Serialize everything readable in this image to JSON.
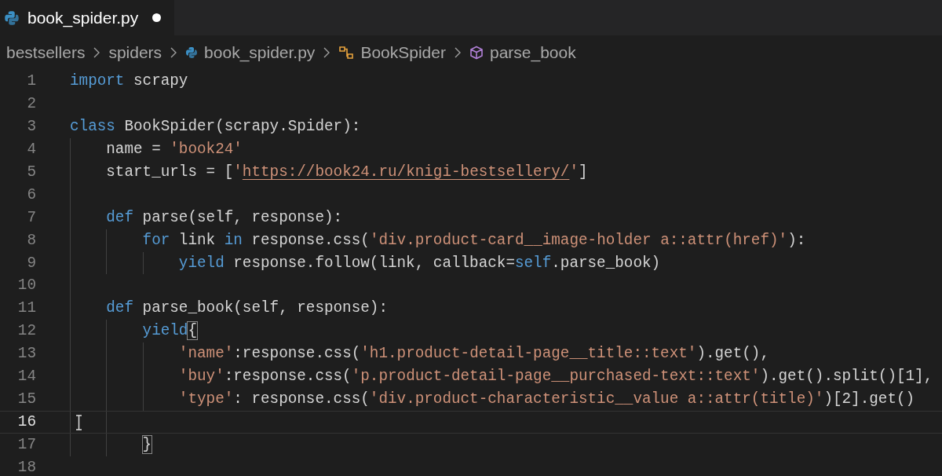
{
  "tab": {
    "title": "book_spider.py",
    "modified": true,
    "selected": true
  },
  "breadcrumbs": [
    {
      "kind": "folder",
      "label": "bestsellers"
    },
    {
      "kind": "folder",
      "label": "spiders"
    },
    {
      "kind": "file",
      "label": "book_spider.py"
    },
    {
      "kind": "class",
      "label": "BookSpider"
    },
    {
      "kind": "method",
      "label": "parse_book"
    }
  ],
  "lines": [
    {
      "number": "1",
      "active": false,
      "tokens": [
        {
          "kind": "kw",
          "text": "import"
        },
        {
          "kind": "plain",
          "text": " scrapy"
        }
      ]
    },
    {
      "number": "2",
      "active": false
    },
    {
      "number": "3",
      "active": false,
      "tokens": [
        {
          "kind": "kw",
          "text": "class"
        },
        {
          "kind": "plain",
          "text": " BookSpider(scrapy.Spider):"
        }
      ]
    },
    {
      "number": "4",
      "active": false,
      "tokens": [
        {
          "kind": "plain",
          "text": "    name = "
        },
        {
          "kind": "str",
          "text": "'book24'"
        }
      ]
    },
    {
      "number": "5",
      "active": false,
      "tokens": [
        {
          "kind": "plain",
          "text": "    start_urls = ["
        },
        {
          "kind": "str",
          "text": "'"
        },
        {
          "kind": "url",
          "text": "https://book24.ru/knigi-bestsellery/"
        },
        {
          "kind": "str",
          "text": "'"
        },
        {
          "kind": "plain",
          "text": "]"
        }
      ]
    },
    {
      "number": "6",
      "active": false
    },
    {
      "number": "7",
      "active": false,
      "tokens": [
        {
          "kind": "kw",
          "text": "    def"
        },
        {
          "kind": "plain",
          "text": " parse(self, response):"
        }
      ]
    },
    {
      "number": "8",
      "active": false,
      "tokens": [
        {
          "kind": "kw",
          "text": "        for"
        },
        {
          "kind": "plain",
          "text": " link "
        },
        {
          "kind": "kw",
          "text": "in"
        },
        {
          "kind": "plain",
          "text": " response.css("
        },
        {
          "kind": "str",
          "text": "'div.product-card__image-holder a::attr(href)'"
        },
        {
          "kind": "plain",
          "text": "):"
        }
      ]
    },
    {
      "number": "9",
      "active": false,
      "tokens": [
        {
          "kind": "kw",
          "text": "            yield"
        },
        {
          "kind": "plain",
          "text": " response.follow(link, callback="
        },
        {
          "kind": "kw",
          "text": "self"
        },
        {
          "kind": "plain",
          "text": ".parse_book)"
        }
      ]
    },
    {
      "number": "10",
      "active": false
    },
    {
      "number": "11",
      "active": false,
      "tokens": [
        {
          "kind": "kw",
          "text": "    def"
        },
        {
          "kind": "plain",
          "text": " parse_book(self, response):"
        }
      ]
    },
    {
      "number": "12",
      "active": false,
      "tokens": [
        {
          "kind": "kw",
          "text": "        yield"
        },
        {
          "kind": "bracket",
          "text": "{"
        }
      ]
    },
    {
      "number": "13",
      "active": false,
      "tokens": [
        {
          "kind": "str",
          "text": "            'name'"
        },
        {
          "kind": "plain",
          "text": ":response.css("
        },
        {
          "kind": "str",
          "text": "'h1.product-detail-page__title::text'"
        },
        {
          "kind": "plain",
          "text": ").get(),"
        }
      ]
    },
    {
      "number": "14",
      "active": false,
      "tokens": [
        {
          "kind": "str",
          "text": "            'buy'"
        },
        {
          "kind": "plain",
          "text": ":response.css("
        },
        {
          "kind": "str",
          "text": "'p.product-detail-page__purchased-text::text'"
        },
        {
          "kind": "plain",
          "text": ").get().split()[1],"
        }
      ]
    },
    {
      "number": "15",
      "active": false,
      "tokens": [
        {
          "kind": "str",
          "text": "            'type'"
        },
        {
          "kind": "plain",
          "text": ": response.css("
        },
        {
          "kind": "str",
          "text": "'div.product-characteristic__value a::attr(title)'"
        },
        {
          "kind": "plain",
          "text": ")[2].get()"
        }
      ]
    },
    {
      "number": "16",
      "active": true
    },
    {
      "number": "17",
      "active": false,
      "tokens": [
        {
          "kind": "bracket",
          "text": "        }"
        }
      ]
    },
    {
      "number": "18",
      "active": false
    }
  ]
}
